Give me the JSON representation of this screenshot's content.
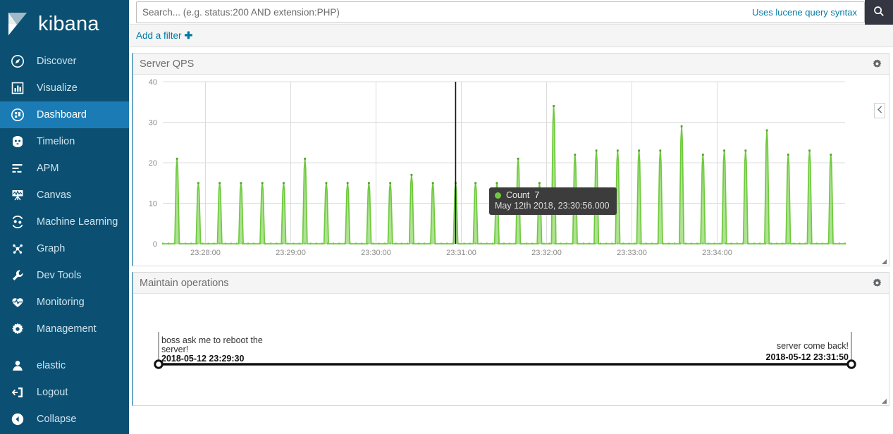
{
  "brand": {
    "name": "kibana",
    "logo_icon": "kibana-logo-icon"
  },
  "sidebar": {
    "items": [
      {
        "label": "Discover",
        "icon": "compass-icon",
        "active": false
      },
      {
        "label": "Visualize",
        "icon": "bar-chart-icon",
        "active": false
      },
      {
        "label": "Dashboard",
        "icon": "dashboard-icon",
        "active": true
      },
      {
        "label": "Timelion",
        "icon": "timelion-icon",
        "active": false
      },
      {
        "label": "APM",
        "icon": "apm-icon",
        "active": false
      },
      {
        "label": "Canvas",
        "icon": "canvas-icon",
        "active": false
      },
      {
        "label": "Machine Learning",
        "icon": "machine-learning-icon",
        "active": false
      },
      {
        "label": "Graph",
        "icon": "graph-icon",
        "active": false
      },
      {
        "label": "Dev Tools",
        "icon": "wrench-icon",
        "active": false
      },
      {
        "label": "Monitoring",
        "icon": "heartbeat-icon",
        "active": false
      },
      {
        "label": "Management",
        "icon": "gear-icon",
        "active": false
      }
    ],
    "footer_items": [
      {
        "label": "elastic",
        "icon": "user-icon"
      },
      {
        "label": "Logout",
        "icon": "logout-icon"
      },
      {
        "label": "Collapse",
        "icon": "collapse-left-icon"
      }
    ],
    "colors": {
      "background": "#0b5072",
      "active": "#1b7cb5",
      "text": "#cfe3ee"
    }
  },
  "search": {
    "placeholder": "Search... (e.g. status:200 AND extension:PHP)",
    "value": "",
    "hint_link": "Uses lucene query syntax",
    "search_button_icon": "search-icon"
  },
  "filter_bar": {
    "add_filter_label": "Add a filter",
    "plus_icon": "plus-icon"
  },
  "panels": [
    {
      "title": "Server QPS",
      "gear_icon": "gear-icon",
      "legend_toggle_icon": "chevron-left-icon",
      "resize_icon": "resize-handle-icon"
    },
    {
      "title": "Maintain operations",
      "gear_icon": "gear-icon",
      "resize_icon": "resize-handle-icon"
    }
  ],
  "tooltip": {
    "series_label": "Count",
    "series_value": "7",
    "timestamp": "May 12th 2018, 23:30:56.000",
    "dot_color": "#6eca3c"
  },
  "timeline": {
    "events": [
      {
        "text": "boss ask me to reboot the server!",
        "timestamp": "2018-05-12 23:29:30",
        "position": "left"
      },
      {
        "text": "server come back!",
        "timestamp": "2018-05-12 23:31:50",
        "position": "right"
      }
    ]
  },
  "chart_data": {
    "type": "area",
    "title": "Server QPS",
    "xlabel": "",
    "ylabel": "Count",
    "ylim": [
      0,
      40
    ],
    "yticks": [
      0,
      10,
      20,
      30,
      40
    ],
    "xticks": [
      "23:28:00",
      "23:29:00",
      "23:30:00",
      "23:31:00",
      "23:32:00",
      "23:33:00",
      "23:34:00"
    ],
    "grid": true,
    "legend": "hidden",
    "series_name": "Count",
    "series_color": "#6eca3c",
    "cursor": {
      "time": "23:30:56",
      "value": 7
    },
    "points": [
      {
        "t": "23:27:40",
        "v": 21
      },
      {
        "t": "23:27:55",
        "v": 15
      },
      {
        "t": "23:28:10",
        "v": 15
      },
      {
        "t": "23:28:25",
        "v": 15
      },
      {
        "t": "23:28:40",
        "v": 15
      },
      {
        "t": "23:28:55",
        "v": 15
      },
      {
        "t": "23:29:10",
        "v": 21
      },
      {
        "t": "23:29:25",
        "v": 15
      },
      {
        "t": "23:29:40",
        "v": 15
      },
      {
        "t": "23:29:55",
        "v": 15
      },
      {
        "t": "23:30:10",
        "v": 15
      },
      {
        "t": "23:30:25",
        "v": 17
      },
      {
        "t": "23:30:40",
        "v": 15
      },
      {
        "t": "23:30:56",
        "v": 15
      },
      {
        "t": "23:31:10",
        "v": 15
      },
      {
        "t": "23:31:25",
        "v": 15
      },
      {
        "t": "23:31:40",
        "v": 21
      },
      {
        "t": "23:31:55",
        "v": 15
      },
      {
        "t": "23:32:05",
        "v": 34
      },
      {
        "t": "23:32:20",
        "v": 22
      },
      {
        "t": "23:32:35",
        "v": 23
      },
      {
        "t": "23:32:50",
        "v": 23
      },
      {
        "t": "23:33:05",
        "v": 23
      },
      {
        "t": "23:33:20",
        "v": 23
      },
      {
        "t": "23:33:35",
        "v": 29
      },
      {
        "t": "23:33:50",
        "v": 22
      },
      {
        "t": "23:34:05",
        "v": 23
      },
      {
        "t": "23:34:20",
        "v": 23
      },
      {
        "t": "23:34:35",
        "v": 28
      },
      {
        "t": "23:34:50",
        "v": 22
      },
      {
        "t": "23:35:05",
        "v": 23
      },
      {
        "t": "23:35:20",
        "v": 22
      }
    ]
  }
}
